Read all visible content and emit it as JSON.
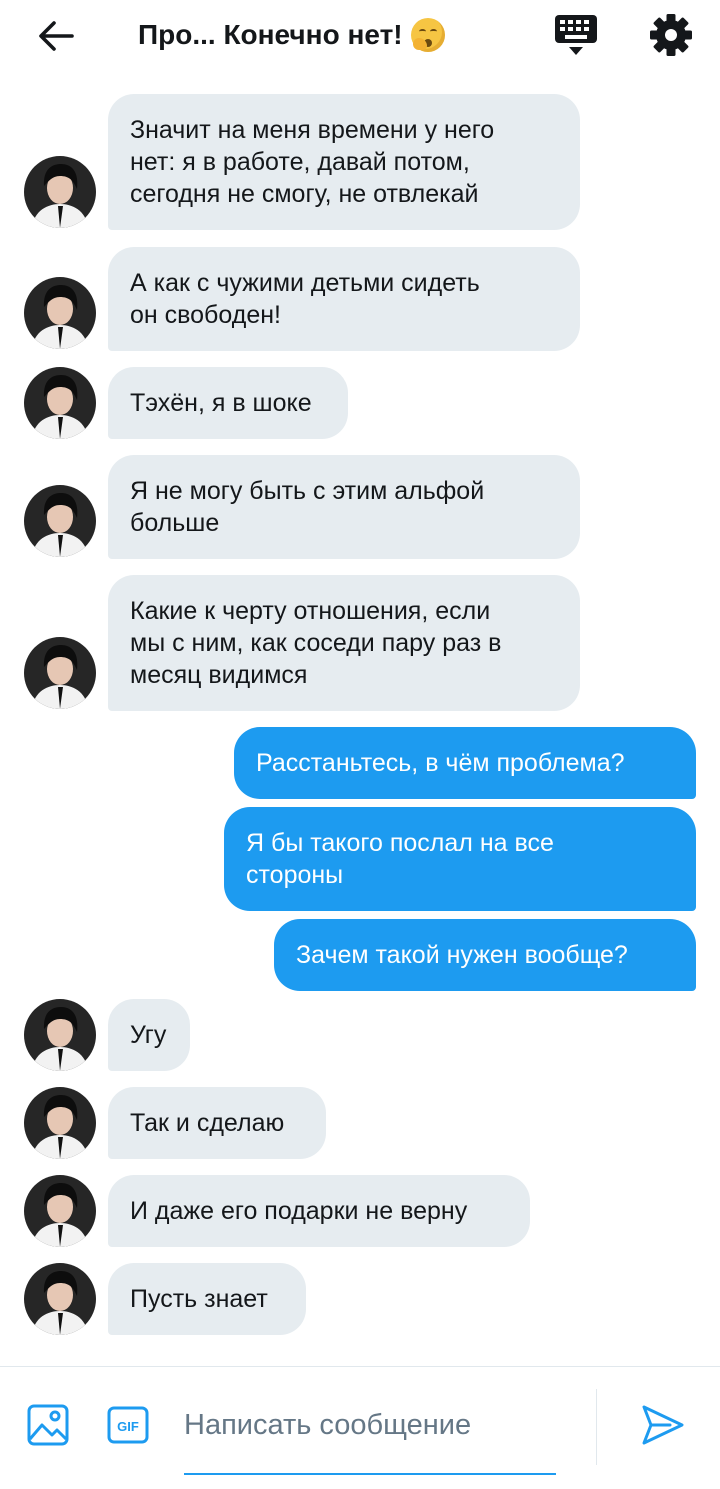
{
  "header": {
    "title": "Про... Конечно нет!",
    "emoji": "yawning-face-emoji"
  },
  "colors": {
    "accent": "#1d9bf0",
    "incoming_bubble": "#e6ecf0",
    "text": "#14171a",
    "placeholder": "#657786"
  },
  "messages": [
    {
      "dir": "in",
      "lines": [
        "Значит на меня времени у него",
        "нет: я в работе, давай потом,",
        "сегодня не смогу, не отвлекай"
      ]
    },
    {
      "dir": "in",
      "lines": [
        "А как с чужими детьми сидеть",
        "он свободен!"
      ]
    },
    {
      "dir": "in",
      "lines": [
        "Тэхён, я в шоке"
      ]
    },
    {
      "dir": "in",
      "lines": [
        "Я не могу быть с этим альфой",
        "больше"
      ]
    },
    {
      "dir": "in",
      "lines": [
        "Какие к черту отношения, если",
        "мы с ним, как соседи пару раз в",
        "месяц видимся"
      ]
    },
    {
      "dir": "out",
      "lines": [
        "Расстаньтесь, в чём проблема?"
      ]
    },
    {
      "dir": "out",
      "lines": [
        "Я бы такого послал на все",
        "стороны"
      ]
    },
    {
      "dir": "out",
      "lines": [
        "Зачем такой нужен вообще?"
      ]
    },
    {
      "dir": "in",
      "lines": [
        "Угу"
      ]
    },
    {
      "dir": "in",
      "lines": [
        "Так и сделаю"
      ]
    },
    {
      "dir": "in",
      "lines": [
        "И даже его подарки не верну"
      ]
    },
    {
      "dir": "in",
      "lines": [
        "Пусть знает"
      ]
    }
  ],
  "composer": {
    "placeholder": "Написать сообщение",
    "gif_label": "GIF",
    "icons": [
      "image-icon",
      "gif-icon",
      "send-icon"
    ]
  },
  "header_icons": [
    "back-arrow-icon",
    "keyboard-icon",
    "gear-icon"
  ]
}
